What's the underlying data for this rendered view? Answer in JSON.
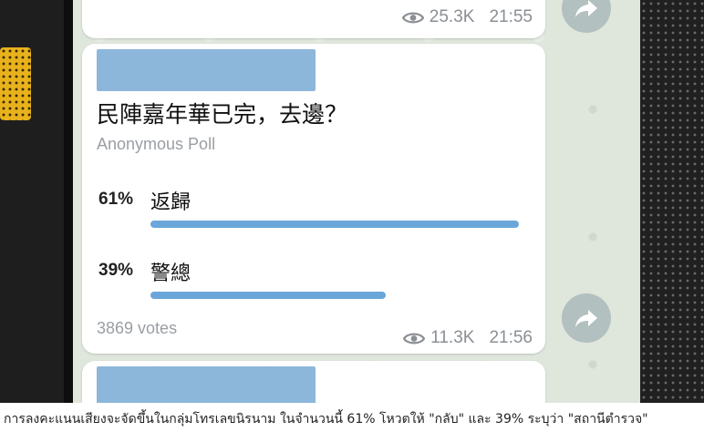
{
  "messages": {
    "top": {
      "views": "25.3K",
      "time": "21:55"
    },
    "poll": {
      "question": "民陣嘉年華已完，去邊？",
      "poll_type": "Anonymous Poll",
      "options": [
        {
          "percent": "61%",
          "label": "返歸",
          "fraction": 0.61
        },
        {
          "percent": "39%",
          "label": "警總",
          "fraction": 0.39
        }
      ],
      "votes": "3869 votes",
      "views": "11.3K",
      "time": "21:56"
    }
  },
  "colors": {
    "bar": "#6aa6d9",
    "sender_placeholder": "#8db6db",
    "meta": "#8b8f94"
  },
  "icons": [
    "eye-icon",
    "share-icon"
  ],
  "caption": "การลงคะแนนเสียงจะจัดขึ้นในกลุ่มโทรเลขนิรนาม ในจำนวนนี้ 61% โหวตให้ \"กลับ\" และ 39% ระบุว่า \"สถานีตำรวจ\""
}
